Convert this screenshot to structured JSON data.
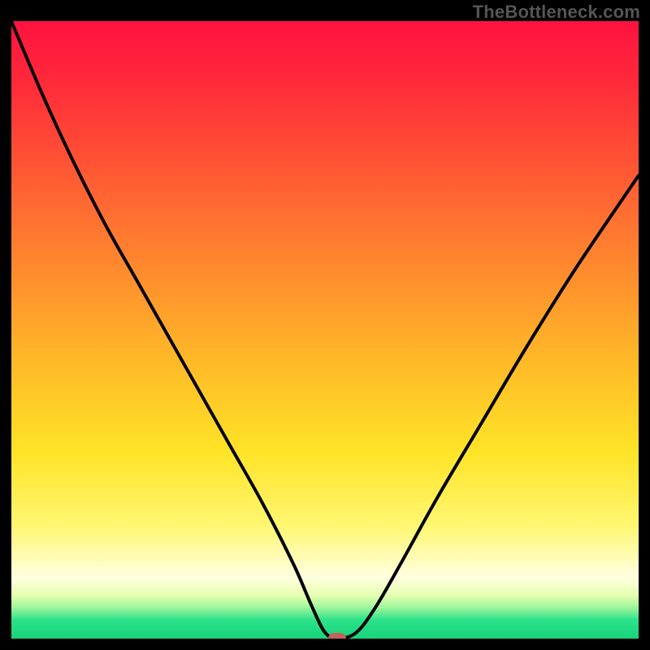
{
  "watermark": "TheBottleneck.com",
  "chart_data": {
    "type": "line",
    "title": "",
    "xlabel": "",
    "ylabel": "",
    "xlim": [
      0,
      100
    ],
    "ylim": [
      0,
      100
    ],
    "grid": false,
    "legend": null,
    "background_gradient": {
      "top_color": "#ff1240",
      "mid_color": "#ffd028",
      "bottom_color": "#18d37a"
    },
    "series": [
      {
        "name": "bottleneck-curve",
        "x": [
          0,
          5,
          10,
          15,
          20,
          25,
          30,
          35,
          40,
          45,
          48,
          50,
          52,
          55,
          58,
          62,
          68,
          75,
          82,
          90,
          100
        ],
        "values": [
          100,
          88,
          77,
          67,
          58,
          49,
          40,
          31,
          22,
          12,
          5,
          1,
          0,
          1,
          5,
          12,
          23,
          35,
          47,
          60,
          75
        ]
      }
    ],
    "marker": {
      "x": 52,
      "y": 0,
      "color": "#c5615b"
    }
  }
}
